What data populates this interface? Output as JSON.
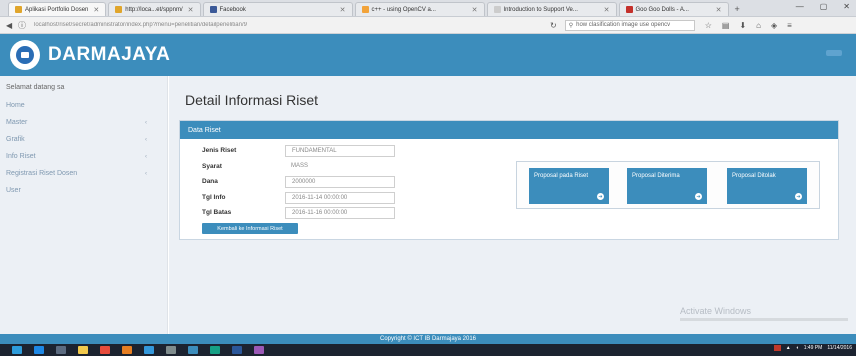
{
  "browser": {
    "tabs": [
      {
        "label": "Aplikasi Portfolio Dosen",
        "favicon_color": "#e0a52b",
        "active": true
      },
      {
        "label": "http://loca...et/sppnm/",
        "favicon_color": "#e0a52b",
        "active": false
      },
      {
        "label": "Facebook",
        "favicon_color": "#3b5998",
        "active": false
      },
      {
        "label": "c++ - using OpenCV a...",
        "favicon_color": "#f2a33a",
        "active": false
      },
      {
        "label": "Introduction to Support Ve...",
        "favicon_color": "#cccccc",
        "active": false
      },
      {
        "label": "Goo Goo Dolls - A...",
        "favicon_color": "#c4302b",
        "active": false
      }
    ],
    "new_tab": "+",
    "window_controls": [
      "—",
      "▢",
      "✕"
    ],
    "url": "localhost/riset/secret/administrator/index.php?menu=penelitian/detailpenelitian/9",
    "search_placeholder": "how clasification image use opencv"
  },
  "app": {
    "brand": "DARMAJAYA",
    "accent_color": "#3c8dbc"
  },
  "sidebar": {
    "welcome": "Selamat datang sa",
    "items": [
      {
        "label": "Home",
        "has_chevron": false
      },
      {
        "label": "Master",
        "has_chevron": true
      },
      {
        "label": "Grafik",
        "has_chevron": true
      },
      {
        "label": "Info Riset",
        "has_chevron": true
      },
      {
        "label": "Registrasi Riset Dosen",
        "has_chevron": true
      },
      {
        "label": "User",
        "has_chevron": false
      }
    ]
  },
  "main": {
    "title": "Detail Informasi Riset",
    "panel_title": "Data Riset",
    "fields": {
      "jenis_label": "Jenis Riset",
      "jenis_value": "FUNDAMENTAL",
      "syarat_label": "Syarat",
      "syarat_value": "MASS",
      "dana_label": "Dana",
      "dana_value": "2000000",
      "tgl_info_label": "Tgl Info",
      "tgl_info_value": "2016-11-14 00:00:00",
      "tgl_batas_label": "Tgl Batas",
      "tgl_batas_value": "2016-11-16 00:00:00"
    },
    "back_button": "Kembali ke Informasi Riset",
    "stats": [
      {
        "label": "Proposal pada Riset"
      },
      {
        "label": "Proposal Diterima"
      },
      {
        "label": "Proposal Ditolak"
      }
    ],
    "watermark": "Activate Windows"
  },
  "footer": {
    "copyright": "Copyright © ICT IB Darmajaya 2016"
  },
  "taskbar": {
    "icons": [
      {
        "name": "start-icon",
        "color": "#2d9cdb"
      },
      {
        "name": "edge-icon",
        "color": "#1e88e5"
      },
      {
        "name": "store-icon",
        "color": "#5c6b80"
      },
      {
        "name": "folder-icon",
        "color": "#f2c94c"
      },
      {
        "name": "chrome-icon",
        "color": "#e74c3c"
      },
      {
        "name": "firefox-icon",
        "color": "#e67e22"
      },
      {
        "name": "app-icon",
        "color": "#3498db"
      },
      {
        "name": "terminal-icon",
        "color": "#7f8c8d"
      },
      {
        "name": "photos-icon",
        "color": "#3c8dbc"
      },
      {
        "name": "mail-icon",
        "color": "#16a085"
      },
      {
        "name": "word-icon",
        "color": "#2b579a"
      },
      {
        "name": "editor-icon",
        "color": "#9b59b6"
      }
    ],
    "time": "1:49 PM",
    "date": "11/14/2016"
  }
}
